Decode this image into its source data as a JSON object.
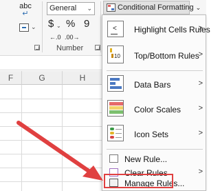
{
  "ribbon": {
    "wrap_text_glyph": "ab",
    "wrap_text_glyph2": "c",
    "merge_dropdown": "⌄",
    "number_format": "General",
    "currency_symbol": "$",
    "percent_symbol": "%",
    "comma_symbol": "9",
    "number_group_label": "Number",
    "conditional_formatting_label": "Conditional Formatting"
  },
  "sheet": {
    "columns": [
      "F",
      "G",
      "H"
    ]
  },
  "menu": {
    "items": [
      {
        "label": "Highlight Cells Rules",
        "has_submenu": true,
        "icon": "highlight-cells-icon"
      },
      {
        "label": "Top/Bottom Rules",
        "has_submenu": true,
        "icon": "top-bottom-icon"
      },
      {
        "label": "Data Bars",
        "has_submenu": true,
        "icon": "data-bars-icon"
      },
      {
        "label": "Color Scales",
        "has_submenu": true,
        "icon": "color-scales-icon"
      },
      {
        "label": "Icon Sets",
        "has_submenu": true,
        "icon": "icon-sets-icon"
      },
      {
        "label": "New Rule...",
        "has_submenu": false,
        "icon": "new-rule-icon"
      },
      {
        "label": "Clear Rules",
        "has_submenu": true,
        "icon": "clear-rules-icon"
      },
      {
        "label": "Manage Rules...",
        "has_submenu": false,
        "icon": "manage-rules-icon"
      }
    ],
    "submenu_arrow": ">",
    "highlight_icon_text": "<",
    "top_bottom_icon_text": "10"
  },
  "colors": {
    "annotation_red": "#e04040",
    "accent_blue": "#4a78c2"
  }
}
